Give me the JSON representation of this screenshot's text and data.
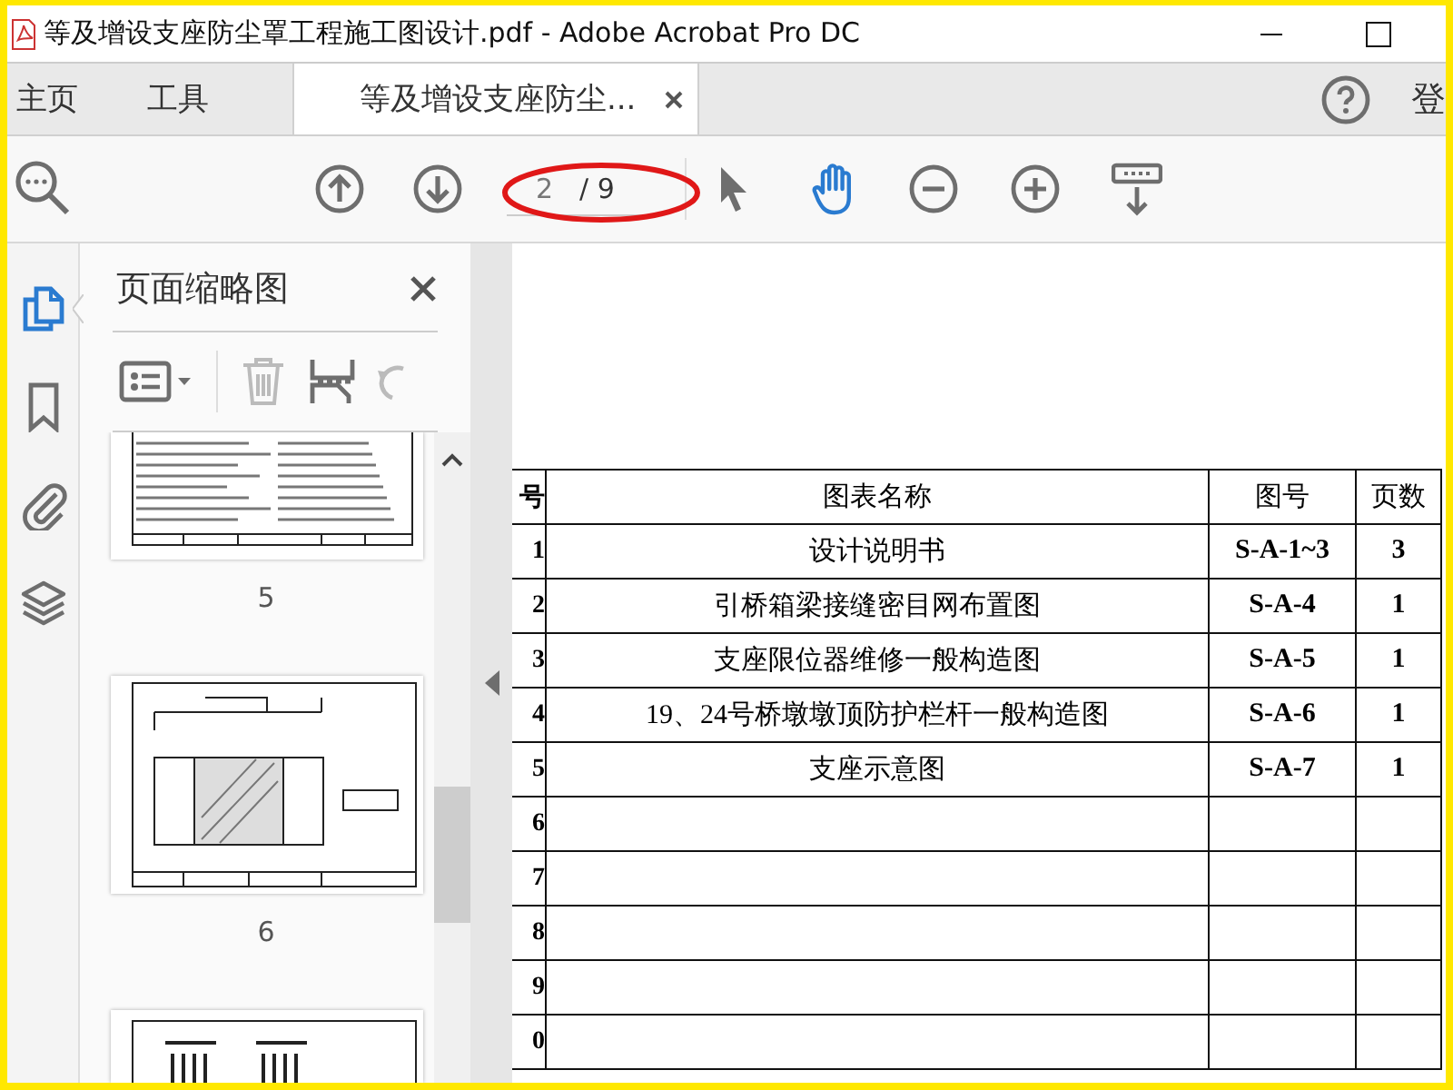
{
  "window": {
    "title": "等及增设支座防尘罩工程施工图设计.pdf - Adobe Acrobat Pro DC"
  },
  "tabs": [
    {
      "label": "主页",
      "selected": false,
      "closable": false
    },
    {
      "label": "工具",
      "selected": false,
      "closable": false
    },
    {
      "label": "等及增设支座防尘...",
      "selected": true,
      "closable": true
    }
  ],
  "sign_in": "登",
  "toolbar": {
    "page_value": "2",
    "page_total": "/ 9",
    "tools": [
      {
        "kind": "select",
        "selected": false
      },
      {
        "kind": "hand",
        "selected": true
      }
    ]
  },
  "side_rail": [
    {
      "kind": "pages",
      "selected": true
    },
    {
      "kind": "bookmarks",
      "selected": false
    },
    {
      "kind": "attachments",
      "selected": false
    },
    {
      "kind": "layers",
      "selected": false
    }
  ],
  "thumbnail_panel": {
    "title": "页面缩略图",
    "thumbnails": [
      {
        "kind": "text",
        "label": "5"
      },
      {
        "kind": "drawing",
        "label": "6"
      },
      {
        "kind": "bars"
      }
    ]
  },
  "table": {
    "columns": [
      "号",
      "图表名称",
      "图号",
      "页数"
    ],
    "rows": [
      [
        "1",
        "设计说明书",
        "S-A-1~3",
        "3"
      ],
      [
        "2",
        "引桥箱梁接缝密目网布置图",
        "S-A-4",
        "1"
      ],
      [
        "3",
        "支座限位器维修一般构造图",
        "S-A-5",
        "1"
      ],
      [
        "4",
        "19、24号桥墩墩顶防护栏杆一般构造图",
        "S-A-6",
        "1"
      ],
      [
        "5",
        "支座示意图",
        "S-A-7",
        "1"
      ],
      [
        "6"
      ],
      [
        "7"
      ],
      [
        "8"
      ],
      [
        "9"
      ],
      [
        "0"
      ]
    ]
  }
}
